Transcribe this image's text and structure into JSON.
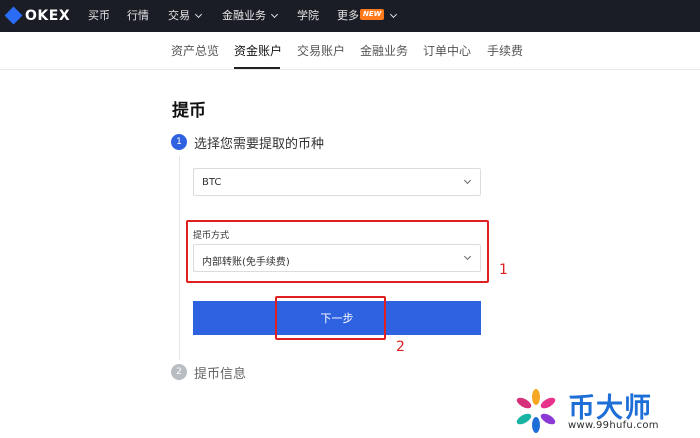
{
  "topnav": {
    "brand": "OKEX",
    "items": [
      {
        "label": "买币"
      },
      {
        "label": "行情"
      },
      {
        "label": "交易"
      },
      {
        "label": "金融业务"
      },
      {
        "label": "学院"
      },
      {
        "label": "更多",
        "badge": "NEW"
      }
    ]
  },
  "subnav": {
    "tabs": [
      {
        "label": "资产总览",
        "active": false
      },
      {
        "label": "资金账户",
        "active": true
      },
      {
        "label": "交易账户",
        "active": false
      },
      {
        "label": "金融业务",
        "active": false
      },
      {
        "label": "订单中心",
        "active": false
      },
      {
        "label": "手续费",
        "active": false
      }
    ]
  },
  "page": {
    "title": "提币",
    "step1": {
      "number": "1",
      "label": "选择您需要提取的币种",
      "color": "#2e62e0"
    },
    "coin_select": {
      "value": "BTC"
    },
    "method": {
      "label": "提币方式",
      "value": "内部转账(免手续费)"
    },
    "next_button": "下一步",
    "step2": {
      "number": "2",
      "label": "提币信息",
      "color": "#b9bcc3"
    }
  },
  "annotations": {
    "box1": "1",
    "box2": "2",
    "color": "#e02020"
  },
  "watermark": {
    "text": "币大师",
    "url": "www.99hufu.com"
  },
  "colors": {
    "topbar": "#1b1d26",
    "accent": "#2e62e0",
    "new_badge": "#ff7a1a"
  }
}
